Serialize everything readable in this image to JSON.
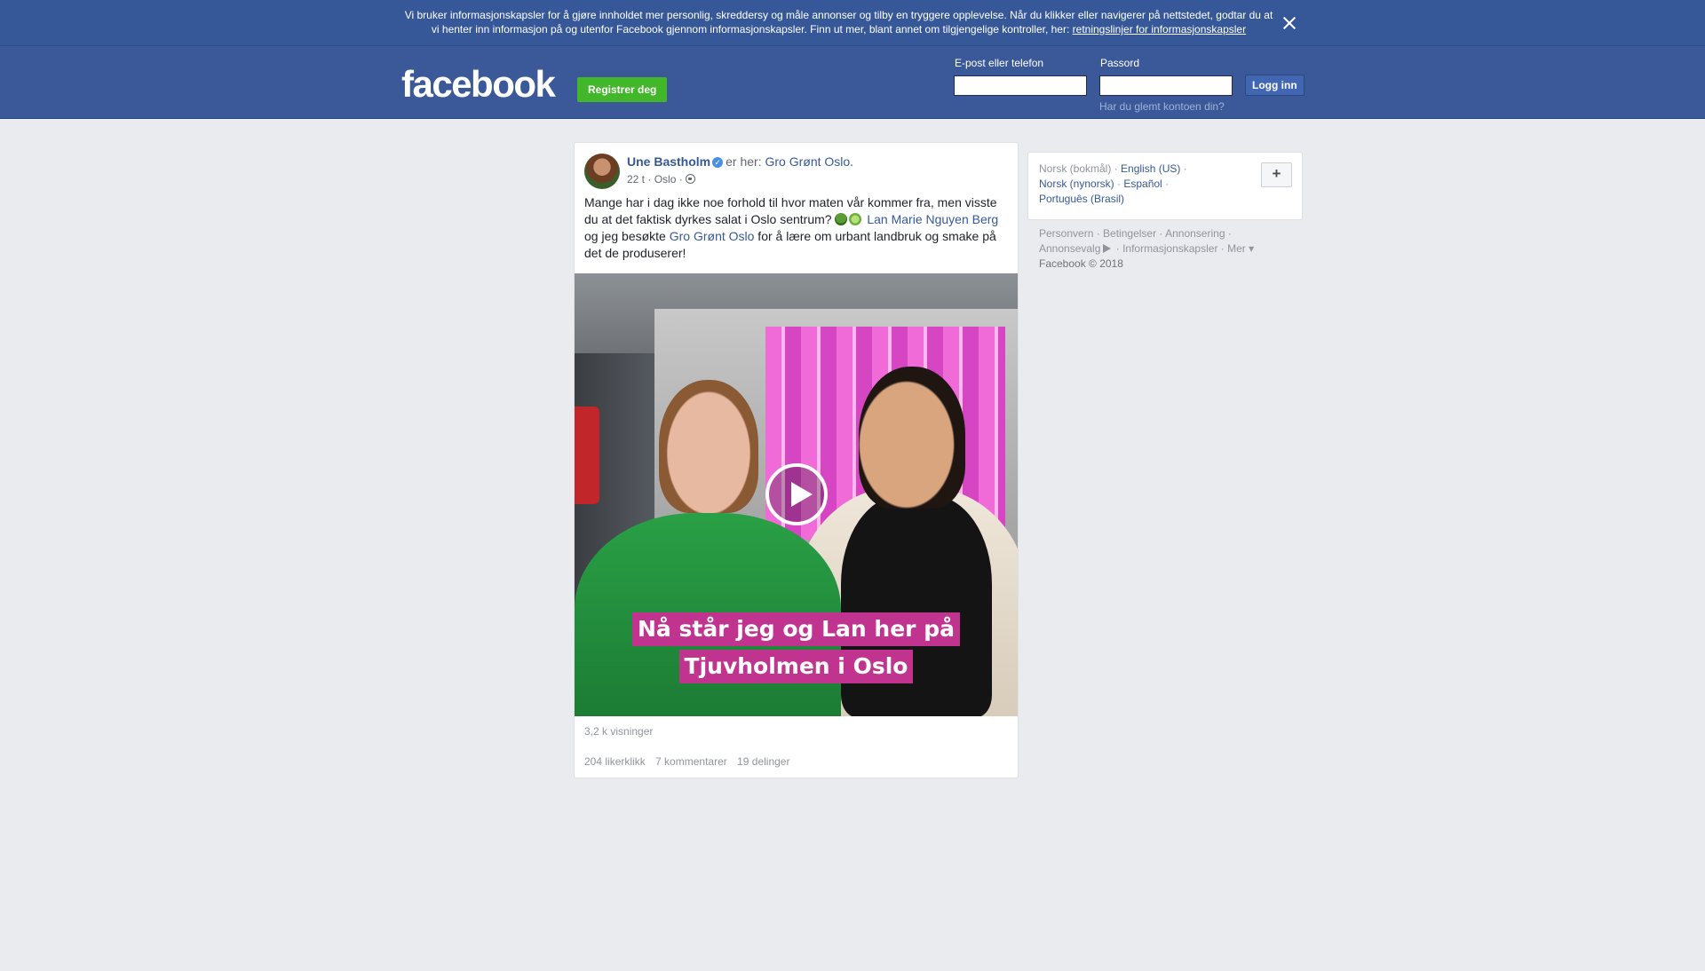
{
  "cookie_banner": {
    "text": "Vi bruker informasjonskapsler for å gjøre innholdet mer personlig, skreddersy og måle annonser og tilby en tryggere opplevelse. Når du klikker eller navigerer på nettstedet, godtar du at vi henter inn informasjon på og utenfor Facebook gjennom informasjonskapsler. Finn ut mer, blant annet om tilgjengelige kontroller, her: ",
    "link": "retningslinjer for informasjonskapsler"
  },
  "header": {
    "logo": "facebook",
    "register_label": "Registrer deg",
    "email_label": "E-post eller telefon",
    "password_label": "Passord",
    "login_label": "Logg inn",
    "forgot_label": "Har du glemt kontoen din?"
  },
  "post": {
    "author": "Une Bastholm",
    "checkin_prefix": "er her:",
    "place": "Gro Grønt Oslo.",
    "time": "22 t",
    "location": "Oslo",
    "text_part1": "Mange har i dag ikke noe forhold til hvor maten vår kommer fra, men visste du at det faktisk dyrkes salat i Oslo sentrum? ",
    "tag1": "Lan Marie Nguyen Berg",
    "text_part2": " og jeg besøkte ",
    "tag2": "Gro Grønt Oslo",
    "text_part3": " for å lære om urbant landbruk og smake på det de produserer!",
    "video_caption_line1": "Nå står jeg og Lan her på",
    "video_caption_line2": "Tjuvholmen i Oslo",
    "views": "3,2 k visninger",
    "likes": "204 likerklikk",
    "comments": "7 kommentarer",
    "shares": "19 delinger"
  },
  "sidebar": {
    "languages": {
      "current": "Norsk (bokmål)",
      "english": "English (US)",
      "nynorsk": "Norsk (nynorsk)",
      "spanish": "Español",
      "portuguese": "Português (Brasil)"
    },
    "plus_label": "+",
    "footer": {
      "privacy": "Personvern",
      "terms": "Betingelser",
      "advertising": "Annonsering",
      "ad_choices": "Annonsevalg",
      "cookies": "Informasjonskapsler",
      "more": "Mer",
      "copyright": "Facebook © 2018"
    }
  },
  "colors": {
    "header_blue": "#3b5998",
    "banner_blue": "#365899",
    "register_green": "#42b72a",
    "link_blue": "#365899",
    "caption_magenta": "#c0338f"
  }
}
